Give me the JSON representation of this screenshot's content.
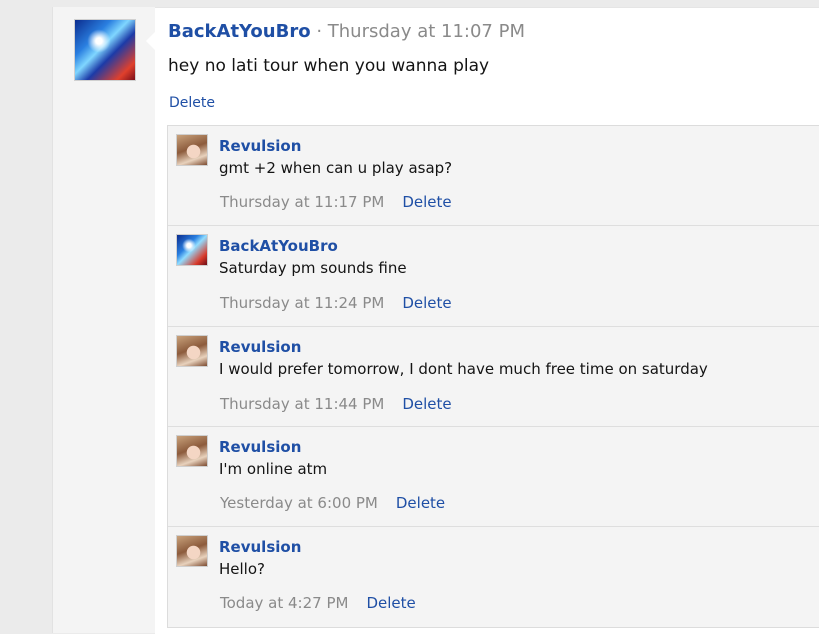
{
  "post": {
    "author": "BackAtYouBro",
    "separator": "·",
    "time": "Thursday at 11:07 PM",
    "text": "hey no lati tour when you wanna play",
    "delete_label": "Delete"
  },
  "comments": [
    {
      "author": "Revulsion",
      "text": "gmt +2 when can u play asap?",
      "time": "Thursday at 11:17 PM",
      "delete_label": "Delete"
    },
    {
      "author": "BackAtYouBro",
      "text": "Saturday pm sounds fine",
      "time": "Thursday at 11:24 PM",
      "delete_label": "Delete"
    },
    {
      "author": "Revulsion",
      "text": "I would prefer tomorrow, I dont have much free time on saturday",
      "time": "Thursday at 11:44 PM",
      "delete_label": "Delete"
    },
    {
      "author": "Revulsion",
      "text": "I'm online atm",
      "time": "Yesterday at 6:00 PM",
      "delete_label": "Delete"
    },
    {
      "author": "Revulsion",
      "text": "Hello?",
      "time": "Today at 4:27 PM",
      "delete_label": "Delete"
    }
  ]
}
